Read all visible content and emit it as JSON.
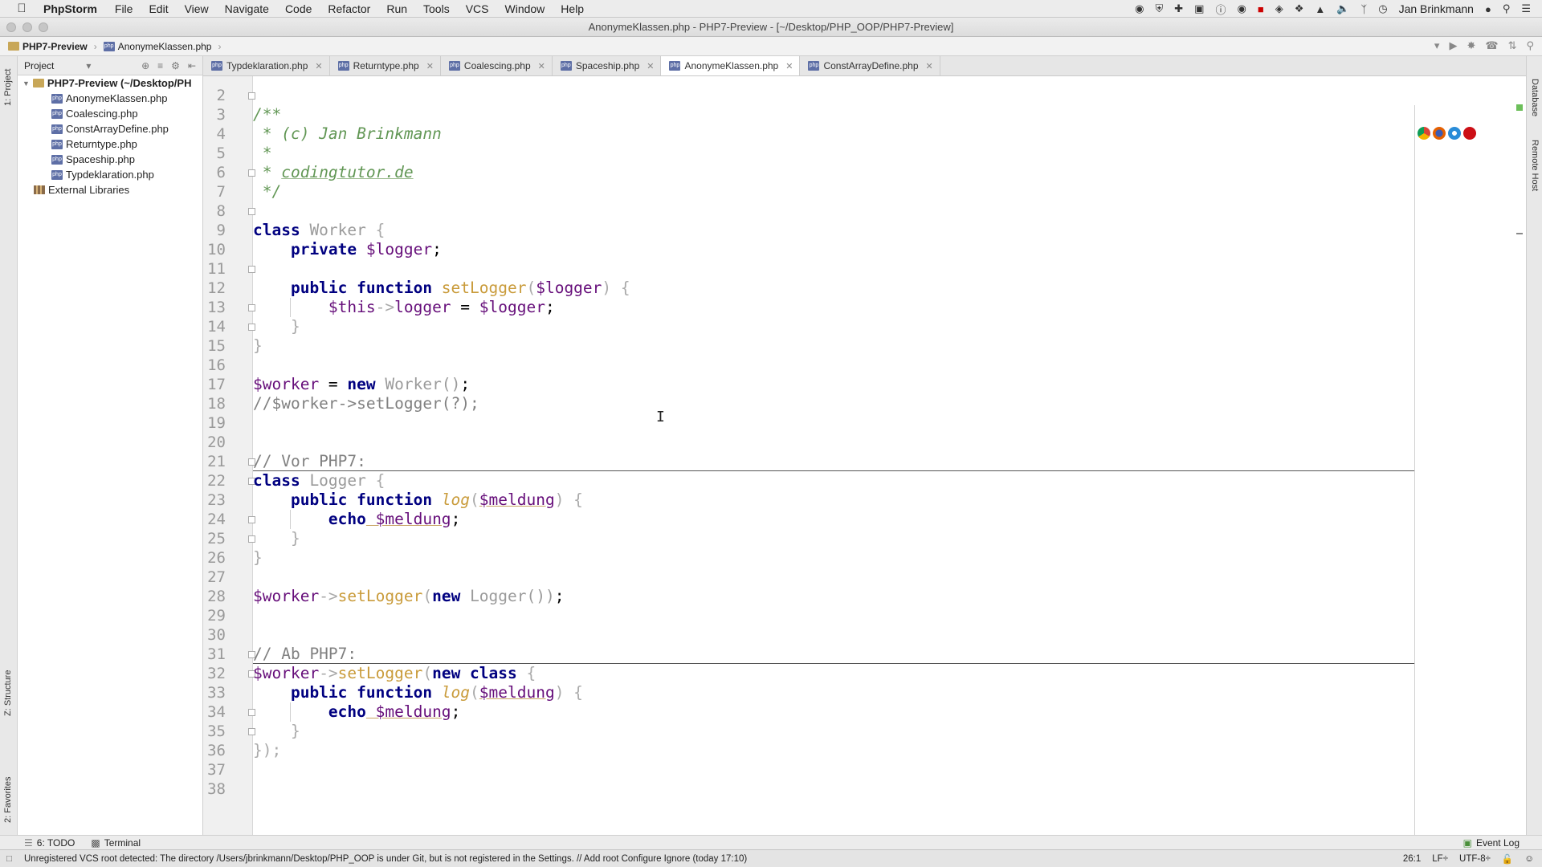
{
  "menubar": {
    "app_name": "PhpStorm",
    "items": [
      "File",
      "Edit",
      "View",
      "Navigate",
      "Code",
      "Refactor",
      "Run",
      "Tools",
      "VCS",
      "Window",
      "Help"
    ],
    "user": "Jan Brinkmann"
  },
  "window": {
    "title": "AnonymeKlassen.php - PHP7-Preview - [~/Desktop/PHP_OOP/PHP7-Preview]"
  },
  "navbar": {
    "project": "PHP7-Preview",
    "file": "AnonymeKlassen.php"
  },
  "left_strip": {
    "project_label": "1: Project",
    "structure_label": "Z: Structure",
    "favorites_label": "2: Favorites"
  },
  "right_strip": {
    "database_label": "Database",
    "remote_label": "Remote Host"
  },
  "project_panel": {
    "header": "Project",
    "root": "PHP7-Preview (~/Desktop/PH",
    "files": [
      "AnonymeKlassen.php",
      "Coalescing.php",
      "ConstArrayDefine.php",
      "Returntype.php",
      "Spaceship.php",
      "Typdeklaration.php"
    ],
    "external": "External Libraries"
  },
  "tabs": [
    {
      "label": "Typdeklaration.php",
      "active": false
    },
    {
      "label": "Returntype.php",
      "active": false
    },
    {
      "label": "Coalescing.php",
      "active": false
    },
    {
      "label": "Spaceship.php",
      "active": false
    },
    {
      "label": "AnonymeKlassen.php",
      "active": true
    },
    {
      "label": "ConstArrayDefine.php",
      "active": false
    }
  ],
  "editor": {
    "line_numbers": [
      "2",
      "3",
      "4",
      "5",
      "6",
      "7",
      "8",
      "9",
      "10",
      "11",
      "12",
      "13",
      "14",
      "15",
      "16",
      "17",
      "18",
      "19",
      "20",
      "21",
      "22",
      "23",
      "24",
      "25",
      "26",
      "27",
      "28",
      "29",
      "30",
      "31",
      "32",
      "33",
      "34",
      "35",
      "36",
      "37",
      "38"
    ],
    "code": {
      "l2": "/**",
      "l3": " * (c) Jan Brinkmann",
      "l4": " *",
      "l5_a": " * ",
      "l5_b": "codingtutor.de",
      "l6": " */",
      "l8_kw": "class",
      "l8_name": " Worker ",
      "l8_br": "{",
      "l9_kw": "    private",
      "l9_var": " $logger",
      "l9_end": ";",
      "l11_kw": "    public function",
      "l11_fn": " setLogger",
      "l11_p1": "(",
      "l11_var": "$logger",
      "l11_p2": ") {",
      "l12_var": "        $this",
      "l12_arrow": "->",
      "l12_prop": "logger",
      "l12_eq": " = ",
      "l12_var2": "$logger",
      "l12_end": ";",
      "l13": "    }",
      "l14": "}",
      "l16_var": "$worker",
      "l16_eq": " = ",
      "l16_kw": "new",
      "l16_cls": " Worker()",
      "l16_end": ";",
      "l17": "//$worker->setLogger(?);",
      "l20": "// Vor PHP7:",
      "l21_kw": "class",
      "l21_name": " Logger ",
      "l21_br": "{",
      "l22_kw": "    public function",
      "l22_fn": " log",
      "l22_p1": "(",
      "l22_var": "$meldung",
      "l22_p2": ") {",
      "l23_kw": "        echo",
      "l23_var": " $meldung",
      "l23_end": ";",
      "l24": "    }",
      "l25": "}",
      "l27_var": "$worker",
      "l27_arrow": "->",
      "l27_fn": "setLogger",
      "l27_p1": "(",
      "l27_kw": "new",
      "l27_cls": " Logger())",
      "l27_end": ";",
      "l30": "// Ab PHP7:",
      "l31_var": "$worker",
      "l31_arrow": "->",
      "l31_fn": "setLogger",
      "l31_p1": "(",
      "l31_kw": "new class",
      "l31_br": " {",
      "l32_kw": "    public function",
      "l32_fn": " log",
      "l32_p1": "(",
      "l32_var": "$meldung",
      "l32_p2": ") {",
      "l33_kw": "        echo",
      "l33_var": " $meldung",
      "l33_end": ";",
      "l34": "    }",
      "l35": "});"
    }
  },
  "bottom_tools": {
    "todo": "6: TODO",
    "terminal": "Terminal",
    "event_log": "Event Log"
  },
  "status": {
    "message": "Unregistered VCS root detected: The directory /Users/jbrinkmann/Desktop/PHP_OOP is under Git, but is not registered in the Settings. // Add root  Configure  Ignore (today 17:10)",
    "position": "26:1",
    "line_sep": "LF÷",
    "encoding": "UTF-8÷"
  }
}
